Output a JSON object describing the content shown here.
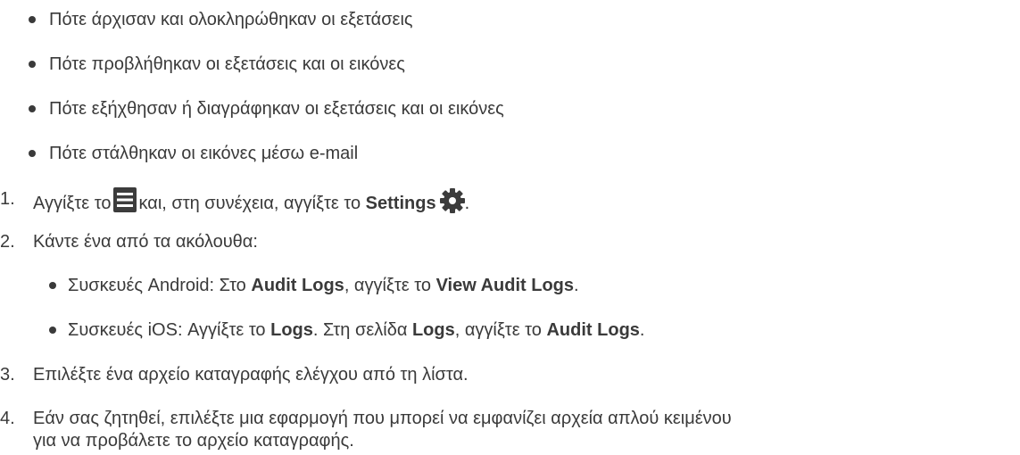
{
  "top_bullets": [
    "Πότε άρχισαν και ολοκληρώθηκαν οι εξετάσεις",
    "Πότε προβλήθηκαν οι εξετάσεις και οι εικόνες",
    "Πότε εξήχθησαν ή διαγράφηκαν οι εξετάσεις και οι εικόνες",
    "Πότε στάλθηκαν οι εικόνες μέσω e-mail"
  ],
  "steps": {
    "s1": {
      "num": "1.",
      "pre": "Αγγίξτε το",
      "mid": "και, στη συνέχεια, αγγίξτε το",
      "bold": "Settings",
      "post": ".",
      "icon1": "menu-icon",
      "icon2": "gear-icon"
    },
    "s2": {
      "num": "2.",
      "text": "Κάντε ένα από τα ακόλουθα:",
      "sub1": {
        "t1": "Συσκευές Android: Στο ",
        "b1": "Audit Logs",
        "t2": ", αγγίξτε το ",
        "b2": "View Audit Logs",
        "t3": "."
      },
      "sub2": {
        "t1": "Συσκευές iOS: Αγγίξτε το ",
        "b1": "Logs",
        "t2": ". Στη σελίδα ",
        "b2": "Logs",
        "t3": ", αγγίξτε το ",
        "b3": "Audit Logs",
        "t4": "."
      }
    },
    "s3": {
      "num": "3.",
      "text": "Επιλέξτε ένα αρχείο καταγραφής ελέγχου από τη λίστα."
    },
    "s4": {
      "num": "4.",
      "line1": "Εάν σας ζητηθεί, επιλέξτε μια εφαρμογή που μπορεί να εμφανίζει αρχεία απλού κειμένου",
      "line2": "για να προβάλετε το αρχείο καταγραφής."
    }
  }
}
